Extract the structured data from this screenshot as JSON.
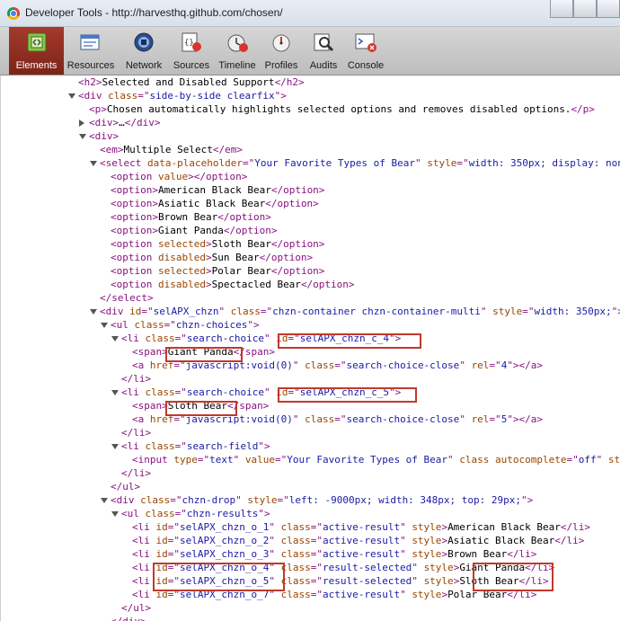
{
  "window": {
    "title": "Developer Tools - http://harvesthq.github.com/chosen/"
  },
  "toolbar": {
    "tabs": [
      {
        "label": "Elements",
        "icon": "elements-icon",
        "active": true
      },
      {
        "label": "Resources",
        "icon": "resources-icon",
        "active": false
      },
      {
        "label": "Network",
        "icon": "network-icon",
        "active": false
      },
      {
        "label": "Sources",
        "icon": "sources-icon",
        "active": false
      },
      {
        "label": "Timeline",
        "icon": "timeline-icon",
        "active": false
      },
      {
        "label": "Profiles",
        "icon": "profiles-icon",
        "active": false
      },
      {
        "label": "Audits",
        "icon": "audits-icon",
        "active": false
      },
      {
        "label": "Console",
        "icon": "console-icon",
        "active": false
      }
    ],
    "active_color": "#8f2f22"
  },
  "code_lines": [
    {
      "arrow": "",
      "parts": [
        [
          "tag",
          "<h2>"
        ],
        [
          "tx",
          "Selected and Disabled Support"
        ],
        [
          "tag",
          "</h2>"
        ]
      ]
    },
    {
      "arrow": "down",
      "parts": [
        [
          "tag",
          "<div "
        ],
        [
          "an",
          "class"
        ],
        [
          "tag",
          "=\""
        ],
        [
          "av",
          "side-by-side clearfix"
        ],
        [
          "tag",
          "\">"
        ]
      ]
    },
    {
      "arrow": "",
      "parts": [
        [
          "tag",
          "<p>"
        ],
        [
          "tx",
          "Chosen automatically highlights selected options and removes disabled options."
        ],
        [
          "tag",
          "</p>"
        ]
      ]
    },
    {
      "arrow": "right",
      "parts": [
        [
          "tag",
          "<div>"
        ],
        [
          "tx",
          "…"
        ],
        [
          "tag",
          "</div>"
        ]
      ]
    },
    {
      "arrow": "down",
      "parts": [
        [
          "tag",
          "<div>"
        ]
      ]
    },
    {
      "arrow": "",
      "parts": [
        [
          "tag",
          "<em>"
        ],
        [
          "tx",
          "Multiple Select"
        ],
        [
          "tag",
          "</em>"
        ]
      ]
    },
    {
      "arrow": "down",
      "parts": [
        [
          "tag",
          "<select "
        ],
        [
          "an",
          "data-placeholder"
        ],
        [
          "tag",
          "=\""
        ],
        [
          "av",
          "Your Favorite Types of Bear"
        ],
        [
          "tag",
          "\" "
        ],
        [
          "an",
          "style"
        ],
        [
          "tag",
          "=\""
        ],
        [
          "av",
          "width: 350px; display: none;"
        ],
        [
          "tag",
          "\">"
        ]
      ]
    },
    {
      "arrow": "",
      "parts": [
        [
          "tag",
          "<option "
        ],
        [
          "an",
          "value"
        ],
        [
          "tag",
          "></option>"
        ]
      ]
    },
    {
      "arrow": "",
      "parts": [
        [
          "tag",
          "<option>"
        ],
        [
          "tx",
          "American Black Bear"
        ],
        [
          "tag",
          "</option>"
        ]
      ]
    },
    {
      "arrow": "",
      "parts": [
        [
          "tag",
          "<option>"
        ],
        [
          "tx",
          "Asiatic Black Bear"
        ],
        [
          "tag",
          "</option>"
        ]
      ]
    },
    {
      "arrow": "",
      "parts": [
        [
          "tag",
          "<option>"
        ],
        [
          "tx",
          "Brown Bear"
        ],
        [
          "tag",
          "</option>"
        ]
      ]
    },
    {
      "arrow": "",
      "parts": [
        [
          "tag",
          "<option>"
        ],
        [
          "tx",
          "Giant Panda"
        ],
        [
          "tag",
          "</option>"
        ]
      ]
    },
    {
      "arrow": "",
      "parts": [
        [
          "tag",
          "<option "
        ],
        [
          "an",
          "selected"
        ],
        [
          "tag",
          ">"
        ],
        [
          "tx",
          "Sloth Bear"
        ],
        [
          "tag",
          "</option>"
        ]
      ]
    },
    {
      "arrow": "",
      "parts": [
        [
          "tag",
          "<option "
        ],
        [
          "an",
          "disabled"
        ],
        [
          "tag",
          ">"
        ],
        [
          "tx",
          "Sun Bear"
        ],
        [
          "tag",
          "</option>"
        ]
      ]
    },
    {
      "arrow": "",
      "parts": [
        [
          "tag",
          "<option "
        ],
        [
          "an",
          "selected"
        ],
        [
          "tag",
          ">"
        ],
        [
          "tx",
          "Polar Bear"
        ],
        [
          "tag",
          "</option>"
        ]
      ]
    },
    {
      "arrow": "",
      "parts": [
        [
          "tag",
          "<option "
        ],
        [
          "an",
          "disabled"
        ],
        [
          "tag",
          ">"
        ],
        [
          "tx",
          "Spectacled Bear"
        ],
        [
          "tag",
          "</option>"
        ]
      ]
    },
    {
      "arrow": "",
      "parts": [
        [
          "tag",
          "</select>"
        ]
      ]
    },
    {
      "arrow": "down",
      "parts": [
        [
          "tag",
          "<div "
        ],
        [
          "an",
          "id"
        ],
        [
          "tag",
          "=\""
        ],
        [
          "av",
          "selAPX_chzn"
        ],
        [
          "tag",
          "\" "
        ],
        [
          "an",
          "class"
        ],
        [
          "tag",
          "=\""
        ],
        [
          "av",
          "chzn-container chzn-container-multi"
        ],
        [
          "tag",
          "\" "
        ],
        [
          "an",
          "style"
        ],
        [
          "tag",
          "=\""
        ],
        [
          "av",
          "width: 350px;"
        ],
        [
          "tag",
          "\">"
        ]
      ]
    },
    {
      "arrow": "down",
      "parts": [
        [
          "tag",
          "<ul "
        ],
        [
          "an",
          "class"
        ],
        [
          "tag",
          "=\""
        ],
        [
          "av",
          "chzn-choices"
        ],
        [
          "tag",
          "\">"
        ]
      ]
    },
    {
      "arrow": "down",
      "parts": [
        [
          "tag",
          "<li "
        ],
        [
          "an",
          "class"
        ],
        [
          "tag",
          "=\""
        ],
        [
          "av",
          "search-choice"
        ],
        [
          "tag",
          "\" "
        ],
        [
          "an",
          "id"
        ],
        [
          "tag",
          "=\""
        ],
        [
          "av",
          "selAPX_chzn_c_4"
        ],
        [
          "tag",
          "\">"
        ]
      ]
    },
    {
      "arrow": "",
      "parts": [
        [
          "tag",
          "<span>"
        ],
        [
          "tx",
          "Giant Panda"
        ],
        [
          "tag",
          "</span>"
        ]
      ]
    },
    {
      "arrow": "",
      "parts": [
        [
          "tag",
          "<a "
        ],
        [
          "an",
          "href"
        ],
        [
          "tag",
          "=\""
        ],
        [
          "av",
          "javascript:void(0)"
        ],
        [
          "tag",
          "\" "
        ],
        [
          "an",
          "class"
        ],
        [
          "tag",
          "=\""
        ],
        [
          "av",
          "search-choice-close"
        ],
        [
          "tag",
          "\" "
        ],
        [
          "an",
          "rel"
        ],
        [
          "tag",
          "=\""
        ],
        [
          "av",
          "4"
        ],
        [
          "tag",
          "\"></a>"
        ]
      ]
    },
    {
      "arrow": "",
      "parts": [
        [
          "tag",
          "</li>"
        ]
      ]
    },
    {
      "arrow": "down",
      "parts": [
        [
          "tag",
          "<li "
        ],
        [
          "an",
          "class"
        ],
        [
          "tag",
          "=\""
        ],
        [
          "av",
          "search-choice"
        ],
        [
          "tag",
          "\" "
        ],
        [
          "an",
          "id"
        ],
        [
          "tag",
          "=\""
        ],
        [
          "av",
          "selAPX_chzn_c_5"
        ],
        [
          "tag",
          "\">"
        ]
      ]
    },
    {
      "arrow": "",
      "parts": [
        [
          "tag",
          "<span>"
        ],
        [
          "tx",
          "Sloth Bear"
        ],
        [
          "tag",
          "</span>"
        ]
      ]
    },
    {
      "arrow": "",
      "parts": [
        [
          "tag",
          "<a "
        ],
        [
          "an",
          "href"
        ],
        [
          "tag",
          "=\""
        ],
        [
          "av",
          "javascript:void(0)"
        ],
        [
          "tag",
          "\" "
        ],
        [
          "an",
          "class"
        ],
        [
          "tag",
          "=\""
        ],
        [
          "av",
          "search-choice-close"
        ],
        [
          "tag",
          "\" "
        ],
        [
          "an",
          "rel"
        ],
        [
          "tag",
          "=\""
        ],
        [
          "av",
          "5"
        ],
        [
          "tag",
          "\"></a>"
        ]
      ]
    },
    {
      "arrow": "",
      "parts": [
        [
          "tag",
          "</li>"
        ]
      ]
    },
    {
      "arrow": "down",
      "parts": [
        [
          "tag",
          "<li "
        ],
        [
          "an",
          "class"
        ],
        [
          "tag",
          "=\""
        ],
        [
          "av",
          "search-field"
        ],
        [
          "tag",
          "\">"
        ]
      ]
    },
    {
      "arrow": "",
      "parts": [
        [
          "tag",
          "<input "
        ],
        [
          "an",
          "type"
        ],
        [
          "tag",
          "=\""
        ],
        [
          "av",
          "text"
        ],
        [
          "tag",
          "\" "
        ],
        [
          "an",
          "value"
        ],
        [
          "tag",
          "=\""
        ],
        [
          "av",
          "Your Favorite Types of Bear"
        ],
        [
          "tag",
          "\" "
        ],
        [
          "an",
          "class"
        ],
        [
          "tag",
          " "
        ],
        [
          "an",
          "autocomplete"
        ],
        [
          "tag",
          "=\""
        ],
        [
          "av",
          "off"
        ],
        [
          "tag",
          "\" "
        ],
        [
          "an",
          "style"
        ],
        [
          "tag",
          "=\""
        ],
        [
          "av",
          "width: 197px;"
        ],
        [
          "tag",
          "\">"
        ]
      ]
    },
    {
      "arrow": "",
      "parts": [
        [
          "tag",
          "</li>"
        ]
      ]
    },
    {
      "arrow": "",
      "parts": [
        [
          "tag",
          "</ul>"
        ]
      ]
    },
    {
      "arrow": "down",
      "parts": [
        [
          "tag",
          "<div "
        ],
        [
          "an",
          "class"
        ],
        [
          "tag",
          "=\""
        ],
        [
          "av",
          "chzn-drop"
        ],
        [
          "tag",
          "\" "
        ],
        [
          "an",
          "style"
        ],
        [
          "tag",
          "=\""
        ],
        [
          "av",
          "left: -9000px; width: 348px; top: 29px;"
        ],
        [
          "tag",
          "\">"
        ]
      ]
    },
    {
      "arrow": "down",
      "parts": [
        [
          "tag",
          "<ul "
        ],
        [
          "an",
          "class"
        ],
        [
          "tag",
          "=\""
        ],
        [
          "av",
          "chzn-results"
        ],
        [
          "tag",
          "\">"
        ]
      ]
    },
    {
      "arrow": "",
      "parts": [
        [
          "tag",
          "<li "
        ],
        [
          "an",
          "id"
        ],
        [
          "tag",
          "=\""
        ],
        [
          "av",
          "selAPX_chzn_o_1"
        ],
        [
          "tag",
          "\" "
        ],
        [
          "an",
          "class"
        ],
        [
          "tag",
          "=\""
        ],
        [
          "av",
          "active-result"
        ],
        [
          "tag",
          "\" "
        ],
        [
          "an",
          "style"
        ],
        [
          "tag",
          ">"
        ],
        [
          "tx",
          "American Black Bear"
        ],
        [
          "tag",
          "</li>"
        ]
      ]
    },
    {
      "arrow": "",
      "parts": [
        [
          "tag",
          "<li "
        ],
        [
          "an",
          "id"
        ],
        [
          "tag",
          "=\""
        ],
        [
          "av",
          "selAPX_chzn_o_2"
        ],
        [
          "tag",
          "\" "
        ],
        [
          "an",
          "class"
        ],
        [
          "tag",
          "=\""
        ],
        [
          "av",
          "active-result"
        ],
        [
          "tag",
          "\" "
        ],
        [
          "an",
          "style"
        ],
        [
          "tag",
          ">"
        ],
        [
          "tx",
          "Asiatic Black Bear"
        ],
        [
          "tag",
          "</li>"
        ]
      ]
    },
    {
      "arrow": "",
      "parts": [
        [
          "tag",
          "<li "
        ],
        [
          "an",
          "id"
        ],
        [
          "tag",
          "=\""
        ],
        [
          "av",
          "selAPX_chzn_o_3"
        ],
        [
          "tag",
          "\" "
        ],
        [
          "an",
          "class"
        ],
        [
          "tag",
          "=\""
        ],
        [
          "av",
          "active-result"
        ],
        [
          "tag",
          "\" "
        ],
        [
          "an",
          "style"
        ],
        [
          "tag",
          ">"
        ],
        [
          "tx",
          "Brown Bear"
        ],
        [
          "tag",
          "</li>"
        ]
      ]
    },
    {
      "arrow": "",
      "parts": [
        [
          "tag",
          "<li "
        ],
        [
          "an",
          "id"
        ],
        [
          "tag",
          "=\""
        ],
        [
          "av",
          "selAPX_chzn_o_4"
        ],
        [
          "tag",
          "\" "
        ],
        [
          "an",
          "class"
        ],
        [
          "tag",
          "=\""
        ],
        [
          "av",
          "result-selected"
        ],
        [
          "tag",
          "\" "
        ],
        [
          "an",
          "style"
        ],
        [
          "tag",
          ">"
        ],
        [
          "tx",
          "Giant Panda"
        ],
        [
          "tag",
          "</li>"
        ]
      ]
    },
    {
      "arrow": "",
      "parts": [
        [
          "tag",
          "<li "
        ],
        [
          "an",
          "id"
        ],
        [
          "tag",
          "=\""
        ],
        [
          "av",
          "selAPX_chzn_o_5"
        ],
        [
          "tag",
          "\" "
        ],
        [
          "an",
          "class"
        ],
        [
          "tag",
          "=\""
        ],
        [
          "av",
          "result-selected"
        ],
        [
          "tag",
          "\" "
        ],
        [
          "an",
          "style"
        ],
        [
          "tag",
          ">"
        ],
        [
          "tx",
          "Sloth Bear"
        ],
        [
          "tag",
          "</li>"
        ]
      ]
    },
    {
      "arrow": "",
      "parts": [
        [
          "tag",
          "<li "
        ],
        [
          "an",
          "id"
        ],
        [
          "tag",
          "=\""
        ],
        [
          "av",
          "selAPX_chzn_o_7"
        ],
        [
          "tag",
          "\" "
        ],
        [
          "an",
          "class"
        ],
        [
          "tag",
          "=\""
        ],
        [
          "av",
          "active-result"
        ],
        [
          "tag",
          "\" "
        ],
        [
          "an",
          "style"
        ],
        [
          "tag",
          ">"
        ],
        [
          "tx",
          "Polar Bear"
        ],
        [
          "tag",
          "</li>"
        ]
      ]
    },
    {
      "arrow": "",
      "parts": [
        [
          "tag",
          "</ul>"
        ]
      ]
    },
    {
      "arrow": "",
      "parts": [
        [
          "tag",
          "</div>"
        ]
      ]
    }
  ],
  "highlight_color": "#c0392b"
}
